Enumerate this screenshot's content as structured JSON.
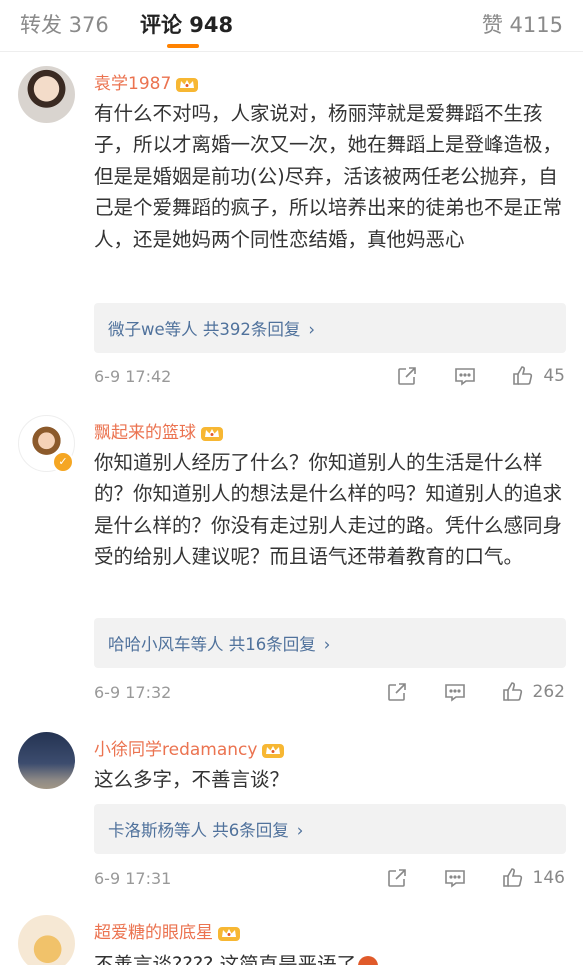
{
  "tabs": {
    "repost": "转发 376",
    "comments": "评论 948",
    "likes": "赞 4115"
  },
  "comments": [
    {
      "username": "袁学1987",
      "text": "有什么不对吗，人家说对，杨丽萍就是爱舞蹈不生孩子，所以才离婚一次又一次，她在舞蹈上是登峰造极，但是是婚姻是前功(公)尽弃，活该被两任老公抛弃，自己是个爱舞蹈的疯子，所以培养出来的徒弟也不是正常人，还是她妈两个同性恋结婚，真他妈恶心",
      "replies": "微子we等人  共392条回复",
      "time": "6-9 17:42",
      "likes": "45"
    },
    {
      "username": "飘起来的篮球",
      "text": "你知道别人经历了什么？你知道别人的生活是什么样的？你知道别人的想法是什么样的吗？知道别人的追求是什么样的？你没有走过别人走过的路。凭什么感同身受的给别人建议呢？而且语气还带着教育的口气。",
      "replies": "哈哈小风车等人  共16条回复",
      "time": "6-9 17:32",
      "likes": "262"
    },
    {
      "username": "小徐同学redamancy",
      "text": "这么多字，不善言谈？",
      "replies": "卡洛斯杨等人  共6条回复",
      "time": "6-9 17:31",
      "likes": "146"
    },
    {
      "username": "超爱糖的眼底星",
      "text": "不善言谈???? 这简直是恶语了"
    }
  ]
}
